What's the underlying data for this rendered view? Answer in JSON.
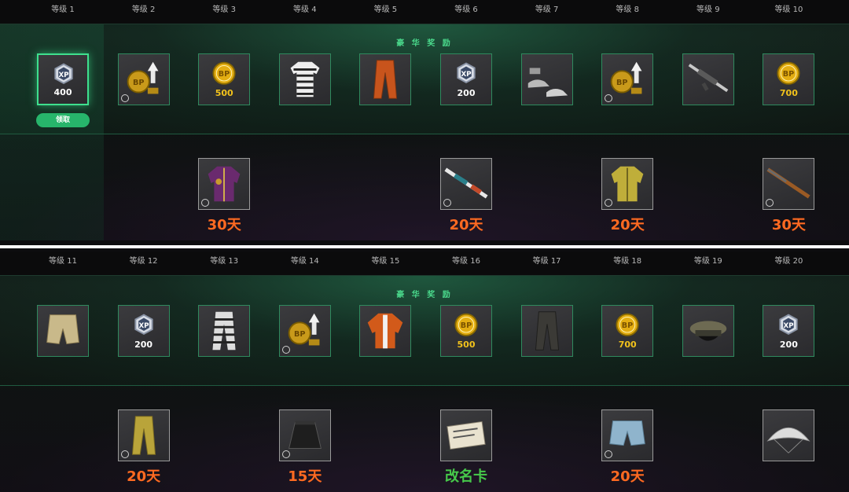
{
  "colors": {
    "accent_green": "#3ee08e",
    "claim_green": "#27b56b",
    "bp_gold": "#f2c21b",
    "days_orange": "#ff6a21",
    "rename_green": "#46c94a"
  },
  "panels": [
    {
      "levels": [
        "等级 1",
        "等级 2",
        "等级 3",
        "等级 4",
        "等级 5",
        "等级 6",
        "等级 7",
        "等级 8",
        "等级 9",
        "等级 10"
      ],
      "premium_label": "豪 华 奖 励",
      "claim_label": "领取",
      "premium": [
        {
          "icon": "xp-icon",
          "amount": "400"
        },
        {
          "icon": "bp-boost-icon",
          "amount": ""
        },
        {
          "icon": "bp-coin-icon",
          "amount": "500"
        },
        {
          "icon": "striped-shirt-icon",
          "amount": ""
        },
        {
          "icon": "orange-pants-icon",
          "amount": ""
        },
        {
          "icon": "xp-icon",
          "amount": "200"
        },
        {
          "icon": "sneakers-icon",
          "amount": ""
        },
        {
          "icon": "bp-boost-icon",
          "amount": ""
        },
        {
          "icon": "rifle-icon",
          "amount": ""
        },
        {
          "icon": "bp-coin-icon",
          "amount": "700"
        }
      ],
      "free": [
        {
          "col": 2,
          "icon": "purple-jacket-icon",
          "label": "30天"
        },
        {
          "col": 5,
          "icon": "shotgun-skin-icon",
          "label": "20天"
        },
        {
          "col": 7,
          "icon": "yellow-jacket-icon",
          "label": "20天"
        },
        {
          "col": 9,
          "icon": "wooden-rifle-icon",
          "label": "30天"
        }
      ]
    },
    {
      "levels": [
        "等级 11",
        "等级 12",
        "等级 13",
        "等级 14",
        "等级 15",
        "等级 16",
        "等级 17",
        "等级 18",
        "等级 19",
        "等级 20"
      ],
      "premium_label": "豪 华 奖 励",
      "premium": [
        {
          "icon": "khaki-shorts-icon",
          "amount": ""
        },
        {
          "icon": "xp-icon",
          "amount": "200"
        },
        {
          "icon": "striped-pants-icon",
          "amount": ""
        },
        {
          "icon": "bp-boost-icon",
          "amount": ""
        },
        {
          "icon": "orange-jacket-icon",
          "amount": ""
        },
        {
          "icon": "bp-coin-icon",
          "amount": "500"
        },
        {
          "icon": "dark-pants-icon",
          "amount": ""
        },
        {
          "icon": "bp-coin-icon",
          "amount": "700"
        },
        {
          "icon": "officer-cap-icon",
          "amount": ""
        },
        {
          "icon": "xp-icon",
          "amount": "200"
        }
      ],
      "free": [
        {
          "col": 1,
          "icon": "yellow-pants-icon",
          "label": "20天"
        },
        {
          "col": 3,
          "icon": "black-skirt-icon",
          "label": "15天"
        },
        {
          "col": 5,
          "icon": "rename-card-icon",
          "label": "改名卡"
        },
        {
          "col": 7,
          "icon": "denim-shorts-icon",
          "label": "20天"
        },
        {
          "col": 9,
          "icon": "parachute-icon",
          "label": ""
        }
      ]
    }
  ]
}
